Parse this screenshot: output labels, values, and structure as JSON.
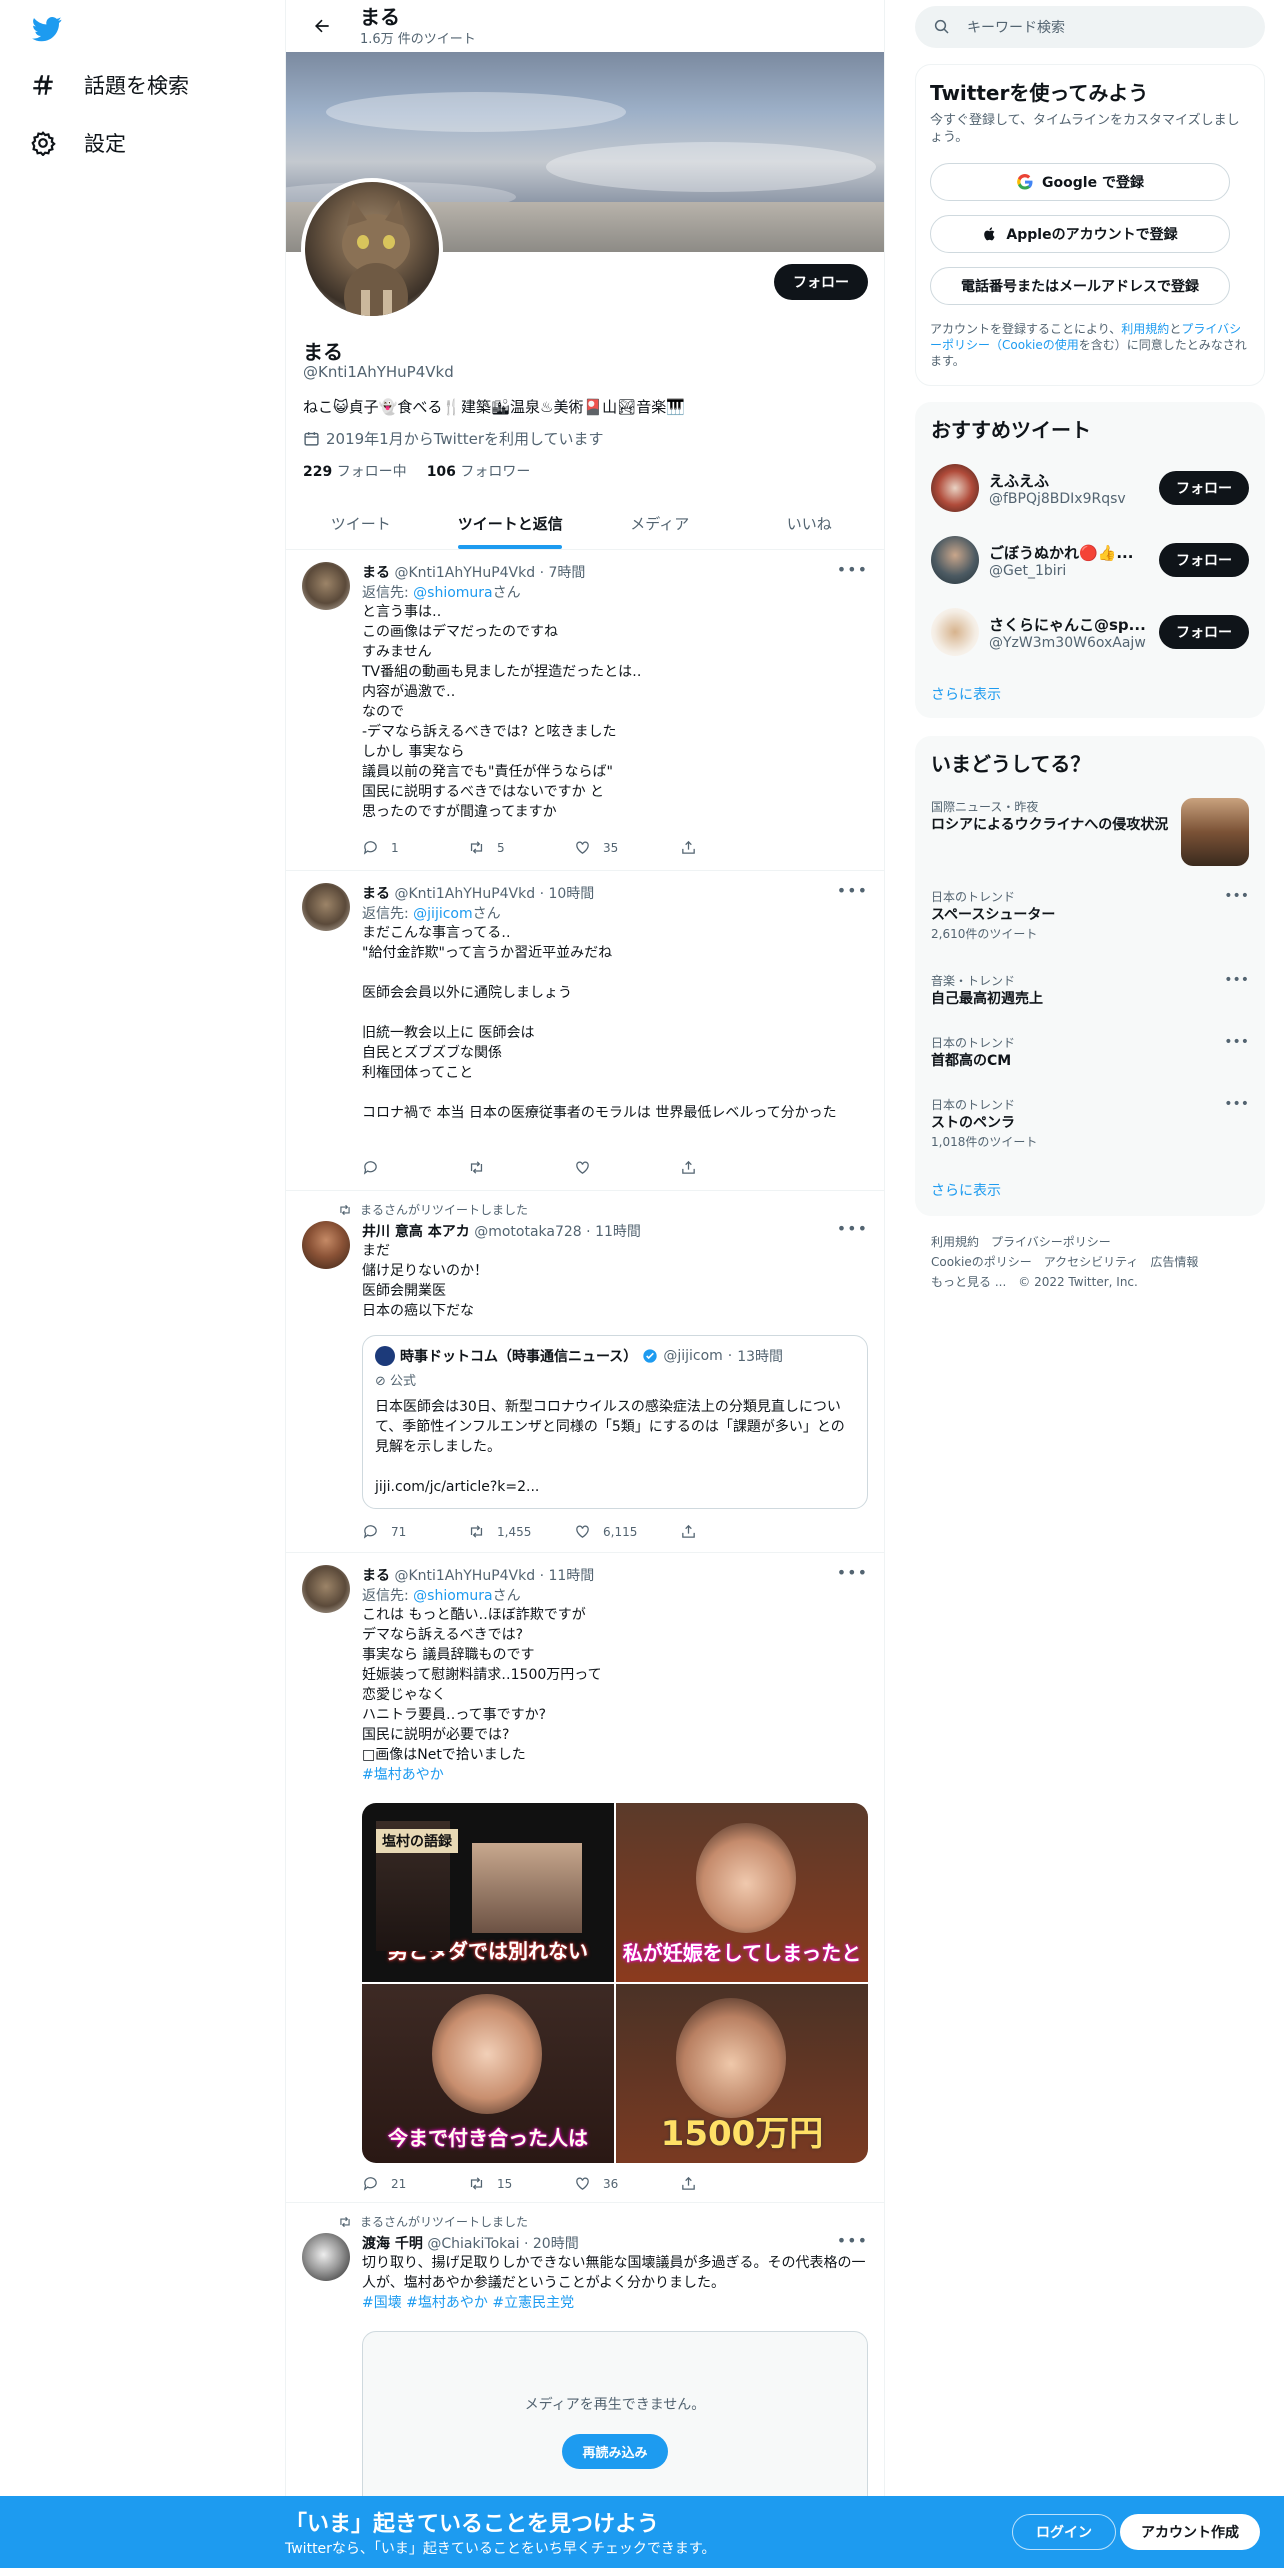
{
  "nav": {
    "explore_label": "話題を検索",
    "settings_label": "設定"
  },
  "header": {
    "title": "まる",
    "subtitle": "1.6万 件のツイート"
  },
  "profile": {
    "name": "まる",
    "handle": "@Knti1AhYHuP4Vkd",
    "bio": "ねこ😺貞子👻食べる🍴建築🏙温泉♨美術🎴山🏞音楽🎹",
    "joined": "2019年1月からTwitterを利用しています",
    "following_count": "229",
    "following_label": "フォロー中",
    "followers_count": "106",
    "followers_label": "フォロワー",
    "follow_label": "フォロー"
  },
  "tabs": [
    "ツイート",
    "ツイートと返信",
    "メディア",
    "いいね"
  ],
  "tweets": [
    {
      "name": "まる",
      "handle": "@Knti1AhYHuP4Vkd",
      "time": "7時間",
      "reply_prefix": "返信先: ",
      "reply_to": "@shiomura",
      "reply_suffix": "さん",
      "text": "と言う事は‥\nこの画像はデマだったのですね\nすみません\nTV番組の動画も見ましたが捏造だったとは‥\n内容が過激で‥\nなので\n-デマなら訴えるべきでは? と呟きました\nしかし 事実なら\n議員以前の発言でも\"責任が伴うならば\"\n国民に説明するべきではないですか と\n思ったのですが間違ってますか",
      "replies": "1",
      "retweets": "5",
      "likes": "35"
    },
    {
      "name": "まる",
      "handle": "@Knti1AhYHuP4Vkd",
      "time": "10時間",
      "reply_prefix": "返信先: ",
      "reply_to": "@jijicom",
      "reply_suffix": "さん",
      "text": "まだこんな事言ってる‥\n\"給付金詐欺\"って言うか習近平並みだね\n\n医師会会員以外に通院しましょう\n\n旧統一教会以上に 医師会は\n自民とズブズブな関係\n利権団体ってこと\n\nコロナ禍で 本当 日本の医療従事者のモラルは 世界最低レベルって分かった",
      "replies": "",
      "retweets": "",
      "likes": ""
    },
    {
      "rt_note": "まるさんがリツイートしました",
      "name": "井川 意高 本アカ",
      "handle": "@mototaka728",
      "time": "11時間",
      "text": "まだ\n儲け足りないのか！\n医師会開業医\n日本の癌以下だな",
      "quote": {
        "name": "時事ドットコム（時事通信ニュース）",
        "handle": "@jijicom",
        "time": "13時間",
        "official": "公式",
        "text": "日本医師会は30日、新型コロナウイルスの感染症法上の分類見直しについて、季節性インフルエンザと同様の「5類」にするのは「課題が多い」との見解を示しました。\n\njiji.com/jc/article?k=2..."
      },
      "replies": "71",
      "retweets": "1,455",
      "likes": "6,115"
    },
    {
      "name": "まる",
      "handle": "@Knti1AhYHuP4Vkd",
      "time": "11時間",
      "reply_prefix": "返信先: ",
      "reply_to": "@shiomura",
      "reply_suffix": "さん",
      "text": "これは もっと酷い‥ほぼ詐欺ですが\nデマなら訴えるべきでは?\n事実なら 議員辞職ものです\n妊娠装って慰謝料請求‥1500万円って\n恋愛じゃなく\nハニトラ要員‥って事ですか?\n国民に説明が必要では?\n□画像はNetで拾いました",
      "hashtag": "#塩村あやか",
      "media": [
        "男とタダでは別れない",
        "私が妊娠をしてしまったと",
        "今まで付き合った人は",
        "1500万円"
      ],
      "media_label": "塩村の語録",
      "replies": "21",
      "retweets": "15",
      "likes": "36"
    },
    {
      "rt_note": "まるさんがリツイートしました",
      "name": "渡海 千明",
      "handle": "@ChiakiTokai",
      "time": "20時間",
      "text": "切り取り、揚げ足取りしかできない無能な国壊議員が多過ぎる。その代表格の一人が、塩村あやか参議だということがよく分かりました。",
      "hashtags": "#国壊 #塩村あやか #立憲民主党",
      "media_error": "メディアを再生できません。",
      "reload": "再読み込み"
    }
  ],
  "search": {
    "placeholder": "キーワード検索"
  },
  "signup": {
    "title": "Twitterを使ってみよう",
    "subtitle": "今すぐ登録して、タイムラインをカスタマイズしましょう。",
    "google": "Google で登録",
    "apple": "Appleのアカウントで登録",
    "phone": "電話番号またはメールアドレスで登録",
    "terms_pre": "アカウントを登録することにより、",
    "terms_link1": "利用規約",
    "terms_mid": "と",
    "terms_link2": "プライバシーポリシー（Cookieの使用",
    "terms_post": "を含む）に同意したとみなされます。"
  },
  "recommend": {
    "title": "おすすめツイート",
    "follow_label": "フォロー",
    "more": "さらに表示",
    "users": [
      {
        "name": "えふえふ",
        "handle": "@fBPQj8BDIx9Rqsv"
      },
      {
        "name": "ごぼうぬかれ🔴👍...",
        "handle": "@Get_1biri"
      },
      {
        "name": "さくらにゃんこ@sp...",
        "handle": "@YzW3m30W6oxAajw"
      }
    ]
  },
  "trends": {
    "title": "いまどうしてる？",
    "more": "さらに表示",
    "items": [
      {
        "context": "国際ニュース・昨夜",
        "name": "ロシアによるウクライナへの侵攻状況",
        "count": ""
      },
      {
        "context": "日本のトレンド",
        "name": "スペースシューター",
        "count": "2,610件のツイート"
      },
      {
        "context": "音楽・トレンド",
        "name": "自己最高初週売上",
        "count": ""
      },
      {
        "context": "日本のトレンド",
        "name": "首都高のCM",
        "count": ""
      },
      {
        "context": "日本のトレンド",
        "name": "ストのペンラ",
        "count": "1,018件のツイート"
      }
    ]
  },
  "footer": [
    "利用規約",
    "プライバシーポリシー",
    "Cookieのポリシー",
    "アクセシビリティ",
    "広告情報",
    "もっと見る ...",
    "© 2022 Twitter, Inc."
  ],
  "bottom_bar": {
    "title": "「いま」起きていることを見つけよう",
    "subtitle": "Twitterなら、「いま」起きていることをいち早くチェックできます。",
    "login": "ログイン",
    "signup": "アカウント作成"
  },
  "colors": {
    "accent": "#1d9bf0",
    "text": "#0f1419",
    "muted": "#536471"
  }
}
